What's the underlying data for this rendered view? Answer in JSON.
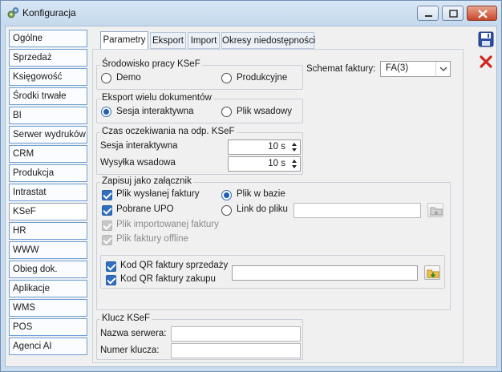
{
  "window": {
    "title": "Konfiguracja"
  },
  "nav": {
    "items": [
      {
        "label": "Ogólne"
      },
      {
        "label": "Sprzedaż"
      },
      {
        "label": "Księgowość"
      },
      {
        "label": "Środki trwałe"
      },
      {
        "label": "BI"
      },
      {
        "label": "Serwer wydruków"
      },
      {
        "label": "CRM"
      },
      {
        "label": "Produkcja"
      },
      {
        "label": "Intrastat"
      },
      {
        "label": "KSeF"
      },
      {
        "label": "HR"
      },
      {
        "label": "WWW"
      },
      {
        "label": "Obieg dok."
      },
      {
        "label": "Aplikacje"
      },
      {
        "label": "WMS"
      },
      {
        "label": "POS"
      },
      {
        "label": "Agenci AI"
      }
    ],
    "active": "KSeF"
  },
  "tabs": [
    {
      "label": "Parametry"
    },
    {
      "label": "Eksport"
    },
    {
      "label": "Import"
    },
    {
      "label": "Okresy niedostępności"
    }
  ],
  "env": {
    "title": "Środowisko pracy KSeF",
    "demo": "Demo",
    "prod": "Produkcyjne"
  },
  "schema": {
    "label": "Schemat faktury:",
    "value": "FA(3)"
  },
  "export": {
    "title": "Eksport wielu dokumentów",
    "interactive": "Sesja interaktywna",
    "batch": "Plik wsadowy"
  },
  "wait": {
    "title": "Czas oczekiwania na odp. KSeF",
    "session_label": "Sesja interaktywna",
    "session_value": "10 s",
    "send_label": "Wysyłka wsadowa",
    "send_value": "10 s"
  },
  "attach": {
    "title": "Zapisuj jako załącznik",
    "sent": "Plik wysłanej faktury",
    "upo": "Pobrane UPO",
    "imported": "Plik importowanej faktury",
    "offline": "Plik faktury offline",
    "in_db": "Plik w bazie",
    "link": "Link do pliku",
    "qr_sales": "Kod QR faktury sprzedaży",
    "qr_purchase": "Kod QR faktury zakupu"
  },
  "key": {
    "title": "Klucz KSeF",
    "server_label": "Nazwa serwera:",
    "number_label": "Numer klucza:"
  },
  "icons": {
    "save": "save-icon",
    "close": "delete-icon",
    "folder": "folder-icon",
    "app": "gear-icon"
  },
  "colors": {
    "accent": "#2f6fc0",
    "title_bar": "#c5d9ee"
  }
}
